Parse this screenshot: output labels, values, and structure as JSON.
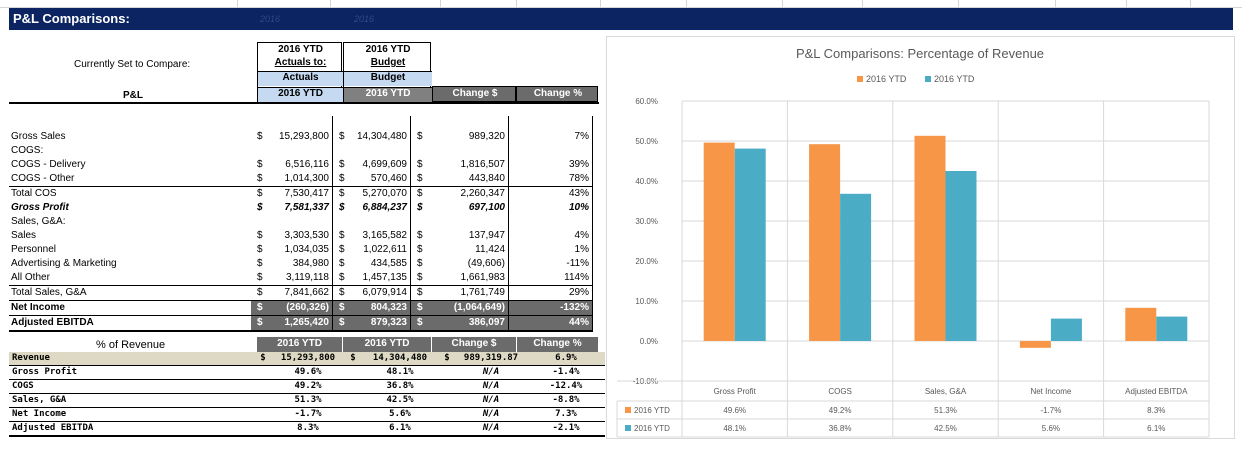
{
  "header": {
    "title": "P&L Comparisons:",
    "ghost1": "2016",
    "ghost2": "2016"
  },
  "compare": {
    "label": "Currently Set to Compare:",
    "col1": [
      "2016 YTD",
      "Actuals to:",
      "Actuals",
      "2016 YTD"
    ],
    "col2": [
      "2016 YTD",
      "Budget",
      "Budget",
      "2016 YTD"
    ],
    "change_dollar": "Change $",
    "change_pct": "Change %",
    "pl_label": "P&L"
  },
  "pl_rows": [
    {
      "label": "",
      "d1": "",
      "v1": "",
      "d2": "",
      "v2": "",
      "d3": "",
      "v3": "",
      "v4": ""
    },
    {
      "label": "Gross Sales",
      "d1": "$",
      "v1": "15,293,800",
      "d2": "$",
      "v2": "14,304,480",
      "d3": "$",
      "v3": "989,320",
      "v4": "7%"
    },
    {
      "label": "COGS:",
      "d1": "",
      "v1": "",
      "d2": "",
      "v2": "",
      "d3": "",
      "v3": "",
      "v4": ""
    },
    {
      "label": "    COGS - Delivery",
      "d1": "$",
      "v1": "6,516,116",
      "d2": "$",
      "v2": "4,699,609",
      "d3": "$",
      "v3": "1,816,507",
      "v4": "39%"
    },
    {
      "label": "    COGS - Other",
      "d1": "$",
      "v1": "1,014,300",
      "d2": "$",
      "v2": "570,460",
      "d3": "$",
      "v3": "443,840",
      "v4": "78%"
    },
    {
      "label": "Total COS",
      "d1": "$",
      "v1": "7,530,417",
      "d2": "$",
      "v2": "5,270,070",
      "d3": "$",
      "v3": "2,260,347",
      "v4": "43%"
    },
    {
      "label": "Gross Profit",
      "d1": "$",
      "v1": "7,581,337",
      "d2": "$",
      "v2": "6,884,237",
      "d3": "$",
      "v3": "697,100",
      "v4": "10%"
    },
    {
      "label": "Sales, G&A:",
      "d1": "",
      "v1": "",
      "d2": "",
      "v2": "",
      "d3": "",
      "v3": "",
      "v4": ""
    },
    {
      "label": "    Sales",
      "d1": "$",
      "v1": "3,303,530",
      "d2": "$",
      "v2": "3,165,582",
      "d3": "$",
      "v3": "137,947",
      "v4": "4%"
    },
    {
      "label": "    Personnel",
      "d1": "$",
      "v1": "1,034,035",
      "d2": "$",
      "v2": "1,022,611",
      "d3": "$",
      "v3": "11,424",
      "v4": "1%"
    },
    {
      "label": "    Advertising & Marketing",
      "d1": "$",
      "v1": "384,980",
      "d2": "$",
      "v2": "434,585",
      "d3": "$",
      "v3": "(49,606)",
      "v4": "-11%"
    },
    {
      "label": "    All Other",
      "d1": "$",
      "v1": "3,119,118",
      "d2": "$",
      "v2": "1,457,135",
      "d3": "$",
      "v3": "1,661,983",
      "v4": "114%"
    },
    {
      "label": "Total Sales, G&A",
      "d1": "$",
      "v1": "7,841,662",
      "d2": "$",
      "v2": "6,079,914",
      "d3": "$",
      "v3": "1,761,749",
      "v4": "29%"
    },
    {
      "label": "Net Income",
      "d1": "$",
      "v1": "(260,326)",
      "d2": "$",
      "v2": "804,323",
      "d3": "$",
      "v3": "(1,064,649)",
      "v4": "-132%"
    },
    {
      "label": "Adjusted EBITDA",
      "d1": "$",
      "v1": "1,265,420",
      "d2": "$",
      "v2": "879,323",
      "d3": "$",
      "v3": "386,097",
      "v4": "44%"
    }
  ],
  "rev": {
    "label": "% of Revenue",
    "h1": "2016 YTD",
    "h2": "2016 YTD",
    "h3": "Change $",
    "h4": "Change %",
    "rows": [
      {
        "label": "Revenue",
        "d1": "$",
        "v1": "15,293,800",
        "d2": "$",
        "v2": "14,304,480",
        "d3": "$",
        "v3": "989,319.87",
        "v4": "6.9%"
      },
      {
        "label": "Gross Profit",
        "d1": "",
        "v1": "49.6%",
        "d2": "",
        "v2": "48.1%",
        "d3": "",
        "v3": "N/A",
        "v4": "-1.4%"
      },
      {
        "label": "COGS",
        "d1": "",
        "v1": "49.2%",
        "d2": "",
        "v2": "36.8%",
        "d3": "",
        "v3": "N/A",
        "v4": "-12.4%"
      },
      {
        "label": "Sales, G&A",
        "d1": "",
        "v1": "51.3%",
        "d2": "",
        "v2": "42.5%",
        "d3": "",
        "v3": "N/A",
        "v4": "-8.8%"
      },
      {
        "label": "Net Income",
        "d1": "",
        "v1": "-1.7%",
        "d2": "",
        "v2": "5.6%",
        "d3": "",
        "v3": "N/A",
        "v4": "7.3%"
      },
      {
        "label": "Adjusted EBITDA",
        "d1": "",
        "v1": "8.3%",
        "d2": "",
        "v2": "6.1%",
        "d3": "",
        "v3": "N/A",
        "v4": "-2.1%"
      }
    ]
  },
  "chart_data": {
    "type": "bar",
    "title": "P&L Comparisons: Percentage of Revenue",
    "categories": [
      "Gross Profit",
      "COGS",
      "Sales, G&A",
      "Net Income",
      "Adjusted EBITDA"
    ],
    "series": [
      {
        "name": "2016 YTD",
        "color": "#f79646",
        "values": [
          49.6,
          49.2,
          51.3,
          -1.7,
          8.3
        ],
        "labels": [
          "49.6%",
          "49.2%",
          "51.3%",
          "-1.7%",
          "8.3%"
        ]
      },
      {
        "name": "2016 YTD",
        "color": "#4bacc6",
        "values": [
          48.1,
          36.8,
          42.5,
          5.6,
          6.1
        ],
        "labels": [
          "48.1%",
          "36.8%",
          "42.5%",
          "5.6%",
          "6.1%"
        ]
      }
    ],
    "ylim": [
      -10,
      60
    ],
    "yticks": [
      -10,
      0,
      10,
      20,
      30,
      40,
      50,
      60
    ],
    "ytick_labels": [
      "-10.0%",
      "0.0%",
      "10.0%",
      "20.0%",
      "30.0%",
      "40.0%",
      "50.0%",
      "60.0%"
    ],
    "legend": "top",
    "grid": true,
    "data_table": true
  }
}
